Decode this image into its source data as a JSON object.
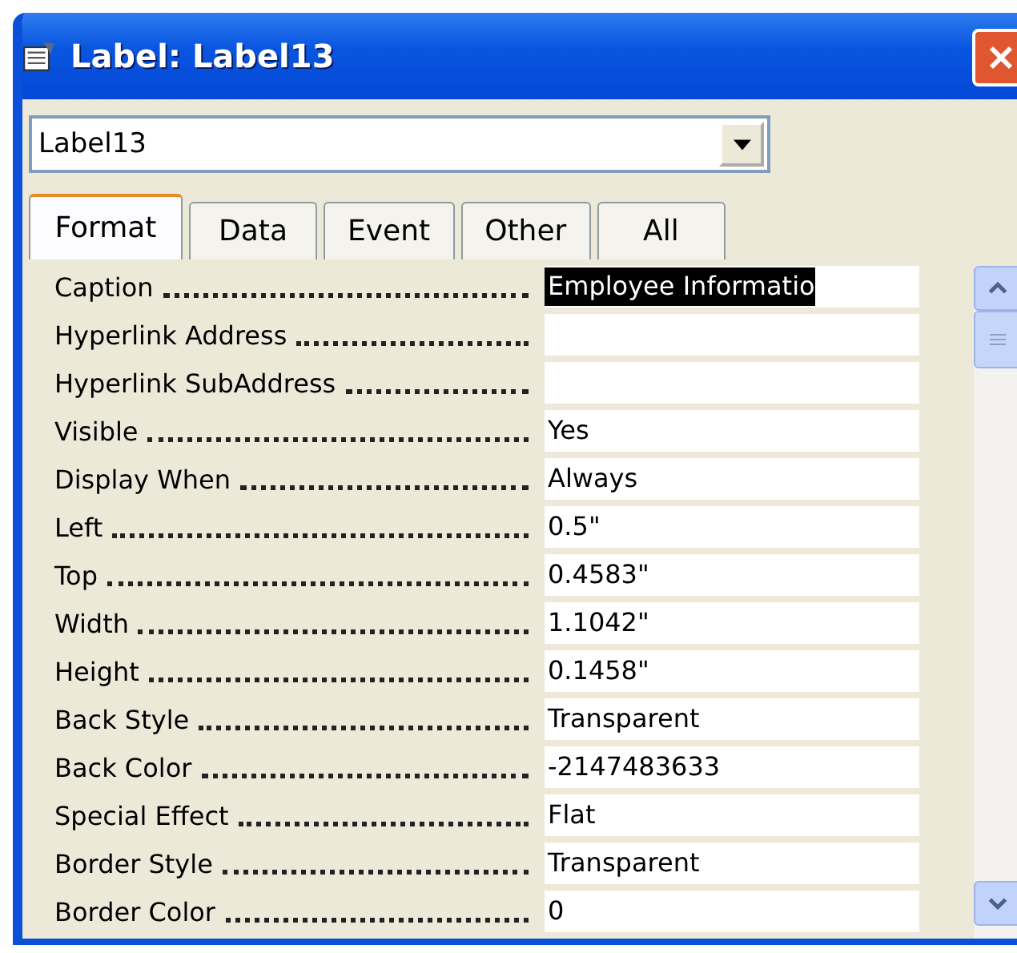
{
  "window": {
    "title": "Label: Label13"
  },
  "object_selector": {
    "value": "Label13"
  },
  "tabs": [
    {
      "label": "Format",
      "selected": true
    },
    {
      "label": "Data",
      "selected": false
    },
    {
      "label": "Event",
      "selected": false
    },
    {
      "label": "Other",
      "selected": false
    },
    {
      "label": "All",
      "selected": false
    }
  ],
  "properties": [
    {
      "name": "Caption",
      "value": "Employee Informatio",
      "selected": true
    },
    {
      "name": "Hyperlink Address",
      "selected": false
    },
    {
      "name": "Hyperlink SubAddress",
      "selected": false
    },
    {
      "name": "Visible",
      "value": "Yes",
      "selected": false
    },
    {
      "name": "Display When",
      "value": "Always",
      "selected": false
    },
    {
      "name": "Left",
      "value": "0.5\"",
      "selected": false
    },
    {
      "name": "Top",
      "value": "0.4583\"",
      "selected": false
    },
    {
      "name": "Width",
      "value": "1.1042\"",
      "selected": false
    },
    {
      "name": "Height",
      "value": "0.1458\"",
      "selected": false
    },
    {
      "name": "Back Style",
      "value": "Transparent",
      "selected": false
    },
    {
      "name": "Back Color",
      "value": "-2147483633",
      "selected": false
    },
    {
      "name": "Special Effect",
      "value": "Flat",
      "selected": false
    },
    {
      "name": "Border Style",
      "value": "Transparent",
      "selected": false
    },
    {
      "name": "Border Color",
      "value": "0",
      "selected": false
    }
  ]
}
